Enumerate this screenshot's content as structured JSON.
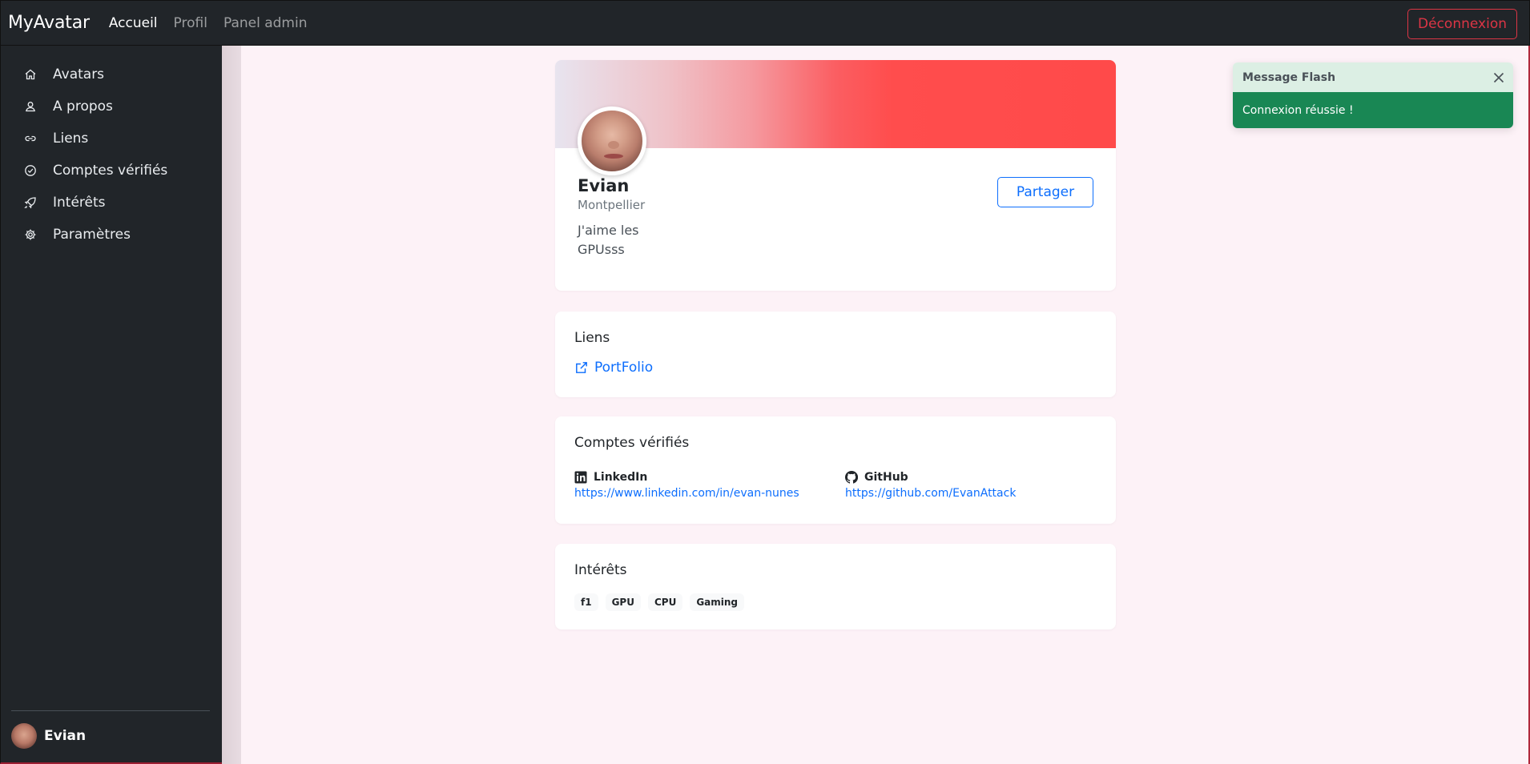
{
  "navbar": {
    "brand": "MyAvatar",
    "links": [
      "Accueil",
      "Profil",
      "Panel admin"
    ],
    "logout_label": "Déconnexion"
  },
  "sidebar": {
    "items": [
      {
        "label": "Avatars",
        "icon": "home-icon"
      },
      {
        "label": "A propos",
        "icon": "user-icon"
      },
      {
        "label": "Liens",
        "icon": "link-icon"
      },
      {
        "label": "Comptes vérifiés",
        "icon": "check-circle-icon"
      },
      {
        "label": "Intérêts",
        "icon": "rocket-icon"
      },
      {
        "label": "Paramètres",
        "icon": "gear-icon"
      }
    ],
    "user_name": "Evian"
  },
  "profile": {
    "name": "Evian",
    "city": "Montpellier",
    "bio": "J'aime les GPUsss",
    "share_label": "Partager",
    "banner_color": "#ff4d4d"
  },
  "links": {
    "title": "Liens",
    "items": [
      {
        "label": "PortFolio",
        "icon": "external-link-icon"
      }
    ]
  },
  "accounts": {
    "title": "Comptes vérifiés",
    "items": [
      {
        "name": "LinkedIn",
        "url": "https://www.linkedin.com/in/evan-nunes",
        "icon": "linkedin-icon"
      },
      {
        "name": "GitHub",
        "url": "https://github.com/EvanAttack",
        "icon": "github-icon"
      }
    ]
  },
  "interests": {
    "title": "Intérêts",
    "tags": [
      "f1",
      "GPU",
      "CPU",
      "Gaming"
    ]
  },
  "toast": {
    "title": "Message Flash",
    "message": "Connexion réussie !",
    "color": "#198754"
  }
}
